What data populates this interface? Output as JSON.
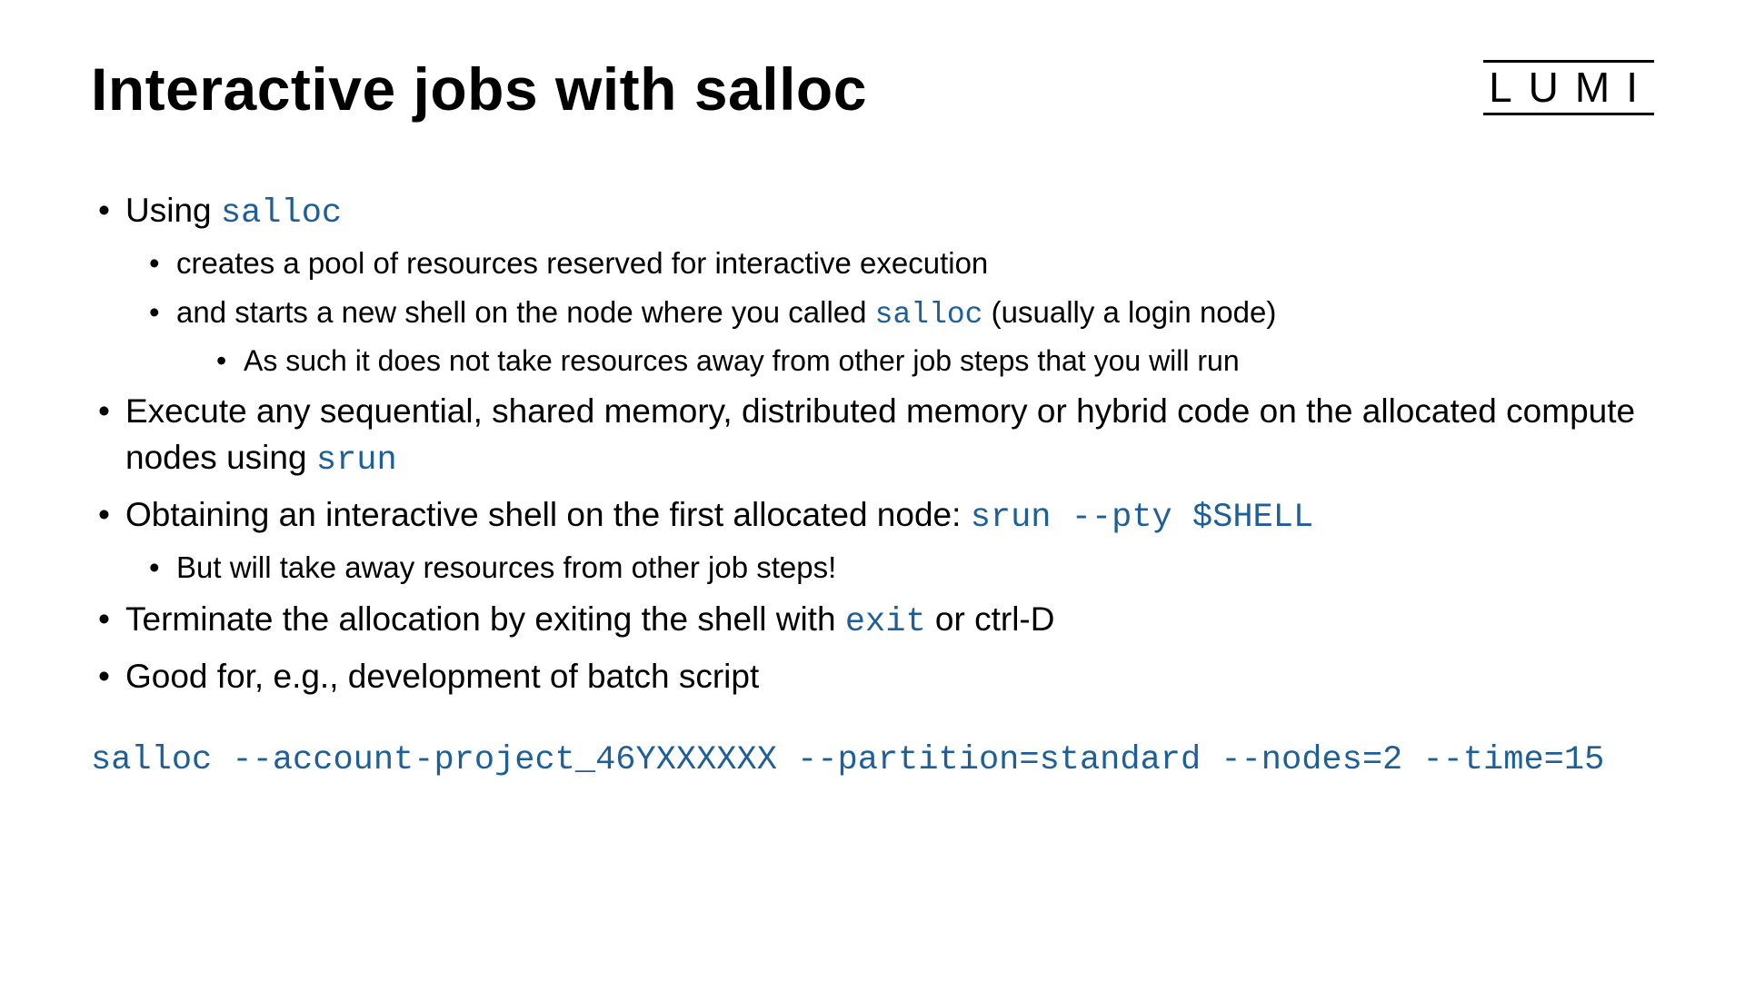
{
  "title": "Interactive jobs with salloc",
  "logo": "LUMI",
  "bullets": {
    "b1_pre": "Using ",
    "b1_code": "salloc",
    "b1_sub1": "creates a pool of resources reserved for interactive execution",
    "b1_sub2_pre": "and starts a new shell on the node where you called ",
    "b1_sub2_code": "salloc",
    "b1_sub2_post": " (usually a login node)",
    "b1_sub2_sub1": "As such it does not take resources away from other job steps that you will run",
    "b2_pre": "Execute any sequential, shared memory, distributed memory or hybrid code on the allocated compute nodes using ",
    "b2_code": "srun",
    "b3_pre": "Obtaining an interactive shell on the first allocated node: ",
    "b3_code": "srun --pty $SHELL",
    "b3_sub1": "But will take away resources from other job steps!",
    "b4_pre": "Terminate the allocation by exiting the shell with ",
    "b4_code": "exit",
    "b4_post": " or ctrl-D",
    "b5": "Good for, e.g., development of batch script"
  },
  "command": "salloc --account-project_46YXXXXXX --partition=standard --nodes=2 --time=15"
}
